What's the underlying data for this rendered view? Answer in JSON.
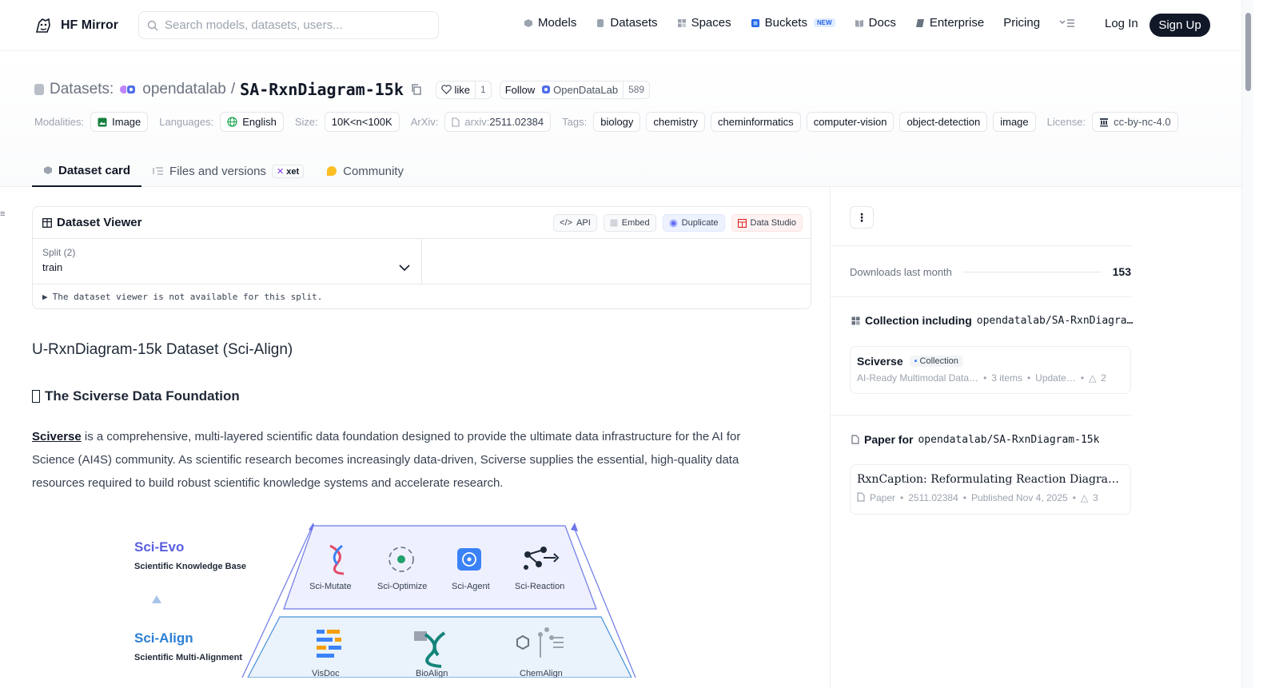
{
  "nav": {
    "brand": "HF Mirror",
    "search_placeholder": "Search models, datasets, users...",
    "links": [
      "Models",
      "Datasets",
      "Spaces",
      "Buckets",
      "Docs",
      "Enterprise",
      "Pricing"
    ],
    "new_badge": "NEW",
    "login": "Log In",
    "signup": "Sign Up"
  },
  "header": {
    "crumb": "Datasets:",
    "owner": "opendatalab",
    "sep": "/",
    "repo": "SA-RxnDiagram-15k",
    "like": "like",
    "like_count": "1",
    "follow": "Follow",
    "follow_org": "OpenDataLab",
    "follow_count": "589"
  },
  "tags": {
    "modalities_label": "Modalities:",
    "modality": "Image",
    "languages_label": "Languages:",
    "language": "English",
    "size_label": "Size:",
    "size": "10K<n<100K",
    "arxiv_label": "ArXiv:",
    "arxiv_prefix": "arxiv:",
    "arxiv": "2511.02384",
    "tags_label": "Tags:",
    "tag_list": [
      "biology",
      "chemistry",
      "cheminformatics",
      "computer-vision",
      "object-detection",
      "image"
    ],
    "license_label": "License:",
    "license": "cc-by-nc-4.0"
  },
  "tabs": {
    "card": "Dataset card",
    "files": "Files and versions",
    "xet": "xet",
    "community": "Community"
  },
  "viewer": {
    "title": "Dataset Viewer",
    "api": "API",
    "embed": "Embed",
    "duplicate": "Duplicate",
    "studio": "Data Studio",
    "split_label": "Split (2)",
    "split_value": "train",
    "notice": "The dataset viewer is not available for this split."
  },
  "content": {
    "h2": "U-RxnDiagram-15k Dataset (Sci-Align)",
    "h3": "The Sciverse Data Foundation",
    "link": "Sciverse",
    "para": " is a comprehensive, multi-layered scientific data foundation designed to provide the ultimate data infrastructure for the AI for Science (AI4S) community. As scientific research becomes increasingly data-driven, Sciverse supplies the essential, high-quality data resources required to build robust scientific knowledge systems and accelerate research."
  },
  "figure": {
    "evo_title": "Sci-Evo",
    "evo_sub": "Scientific Knowledge Base",
    "align_title": "Sci-Align",
    "align_sub": "Scientific Multi-Alignment",
    "top_items": [
      "Sci-Mutate",
      "Sci-Optimize",
      "Sci-Agent",
      "Sci-Reaction"
    ],
    "bottom_items": [
      "VisDoc",
      "BioAlign",
      "ChemAlign"
    ],
    "accent": "#5a5fe0",
    "accent2": "#2b7fd4"
  },
  "sidebar": {
    "downloads_label": "Downloads last month",
    "downloads": "153",
    "collection_title": "Collection including",
    "collection_repo": "opendatalab/SA-RxnDiagra…",
    "coll_name": "Sciverse",
    "coll_badge": "Collection",
    "coll_desc": "AI-Ready Multimodal Data…",
    "coll_items": "3 items",
    "coll_updated": "Update…",
    "coll_likes": "2",
    "paper_title_label": "Paper for",
    "paper_repo": "opendatalab/SA-RxnDiagram-15k",
    "paper_name": "RxnCaption: Reformulating Reaction Diagram Par…",
    "paper_tag": "Paper",
    "paper_id": "2511.02384",
    "paper_date": "Published Nov 4, 2025",
    "paper_likes": "3"
  }
}
